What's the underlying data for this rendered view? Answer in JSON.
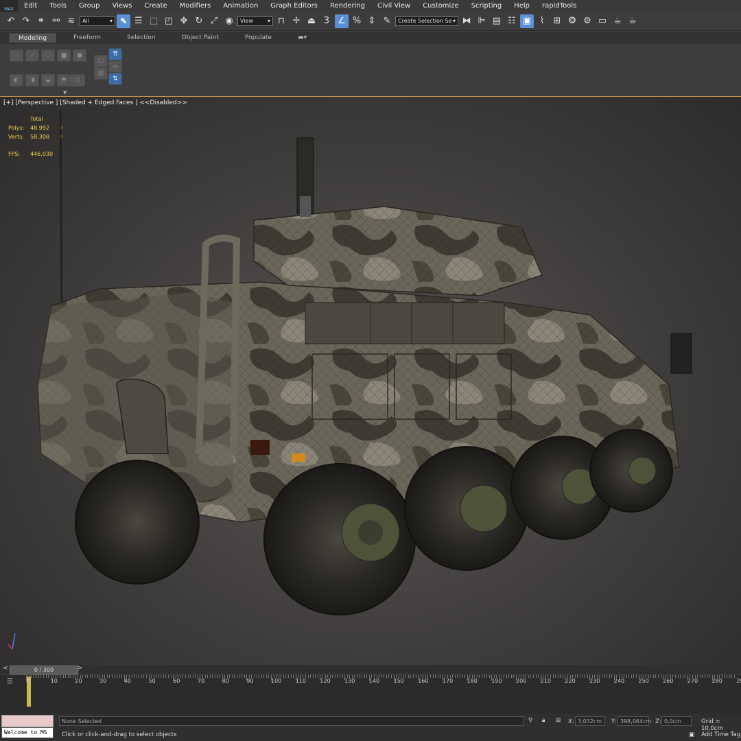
{
  "app": {
    "logo_text": "MAX"
  },
  "menu": [
    "Edit",
    "Tools",
    "Group",
    "Views",
    "Create",
    "Modifiers",
    "Animation",
    "Graph Editors",
    "Rendering",
    "Civil View",
    "Customize",
    "Scripting",
    "Help",
    "rapidTools"
  ],
  "toolbar": {
    "filter_value": "All",
    "ref_coord_value": "View",
    "selection_set_placeholder": "Create Selection Se",
    "snap_label": "3"
  },
  "ribbon": {
    "tabs": [
      "Modeling",
      "Freeform",
      "Selection",
      "Object Paint",
      "Populate"
    ]
  },
  "viewport": {
    "label": "[+] [Perspective ] [Shaded + Edged Faces ]  <<Disabled>>",
    "stats": {
      "header": "Total",
      "rows": [
        {
          "k": "Polys:",
          "v": "48.992",
          "s": "0"
        },
        {
          "k": "Verts:",
          "v": "58.308",
          "s": "0"
        }
      ],
      "fps_label": "FPS:",
      "fps_value": "446,030"
    }
  },
  "timeline": {
    "slider_text": "0 / 300",
    "prev": "<",
    "next": ">",
    "ticks": [
      "0",
      "10",
      "20",
      "30",
      "40",
      "50",
      "60",
      "70",
      "80",
      "90",
      "100",
      "110",
      "120",
      "130",
      "140",
      "150",
      "160",
      "170",
      "180",
      "190",
      "200",
      "210",
      "220",
      "230",
      "240",
      "250",
      "260",
      "270",
      "280",
      "29"
    ]
  },
  "status": {
    "listener": "Welcome to MS",
    "selection": "None Selected",
    "prompt": "Click or click-and-drag to select objects",
    "x_label": "X:",
    "x_value": "3,032cm",
    "y_label": "Y:",
    "y_value": "398,064cm",
    "z_label": "Z:",
    "z_value": "0,0cm",
    "grid": "Grid = 10,0cm",
    "add_time_tag": "Add Time Tag"
  },
  "colors": {
    "accent": "#5b8fd6",
    "stats_text": "#f0d24a",
    "separator": "#c9a44a"
  }
}
